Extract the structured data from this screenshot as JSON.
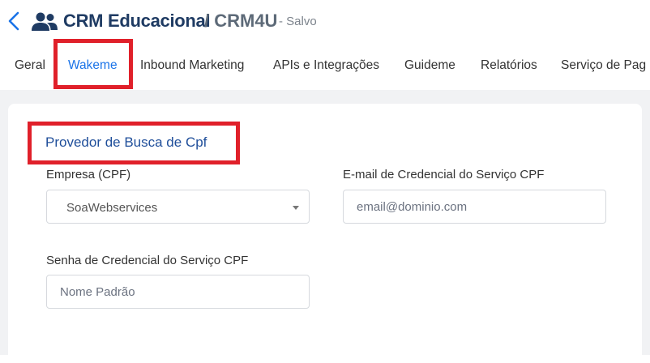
{
  "header": {
    "title": "CRM Educacional",
    "subtitle": "/ CRM4U",
    "status": "- Salvo"
  },
  "tabs": [
    {
      "label": "Geral"
    },
    {
      "label": "Wakeme"
    },
    {
      "label": "Inbound Marketing"
    },
    {
      "label": "APIs e Integrações"
    },
    {
      "label": "Guideme"
    },
    {
      "label": "Relatórios"
    },
    {
      "label": "Serviço de Pag"
    }
  ],
  "form": {
    "section_title": "Provedor de Busca de Cpf",
    "company_label": "Empresa (CPF)",
    "company_value": "SoaWebservices",
    "email_label": "E-mail de Credencial do Serviço CPF",
    "email_placeholder": "email@dominio.com",
    "password_label": "Senha de Credencial do Serviço CPF",
    "password_placeholder": "Nome Padrão"
  },
  "colors": {
    "accent": "#1a73e8",
    "title": "#1f3b63",
    "highlight": "#e0202a"
  }
}
